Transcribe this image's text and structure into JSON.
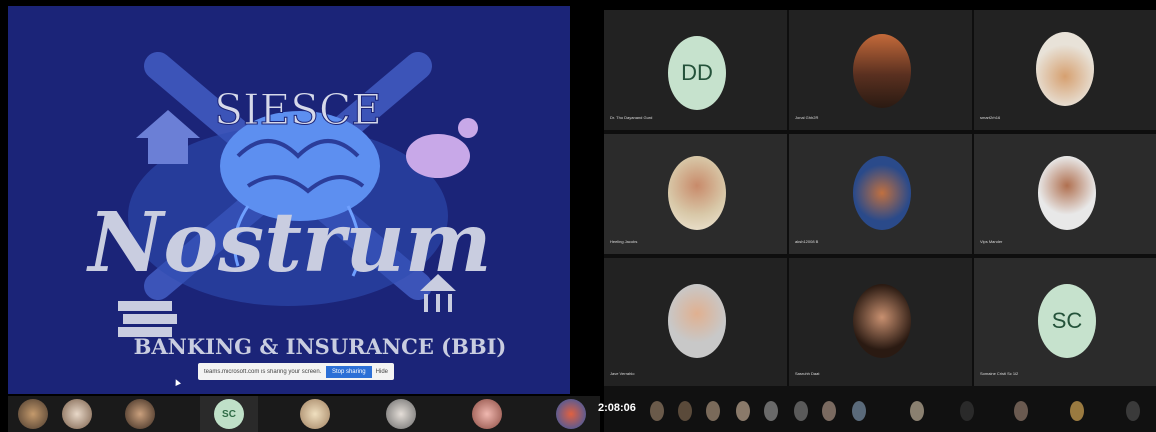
{
  "slide": {
    "title": "SIESCE",
    "main_word": "Nostrum",
    "subtitle": "BANKING & INSURANCE (BBI)",
    "colors": {
      "background": "#1b2478",
      "accent": "#6b7fd6",
      "brain": "#5d8ff0",
      "text": "#c9cde0"
    }
  },
  "share_bar": {
    "message": "teams.microsoft.com is sharing your screen.",
    "stop_label": "Stop sharing",
    "hide_label": "Hide"
  },
  "left_strip": {
    "sc_initials": "SC"
  },
  "participants": [
    {
      "name": "Dr. Tho Dayanand Gurd",
      "initials": "DD"
    },
    {
      "name": "Jonal Ghh2R",
      "initials": ""
    },
    {
      "name": "smart2rh16",
      "initials": ""
    },
    {
      "name": "Heeling Jacobs",
      "initials": ""
    },
    {
      "name": "aksh12008 B",
      "initials": ""
    },
    {
      "name": "Vips Mander",
      "initials": ""
    },
    {
      "name": "Jave Verrahlo",
      "initials": ""
    },
    {
      "name": "Sasruhh Daat",
      "initials": ""
    },
    {
      "name": "Somaine Cristi Sc 1i2",
      "initials": "SC"
    }
  ],
  "clock": "2:08:06"
}
